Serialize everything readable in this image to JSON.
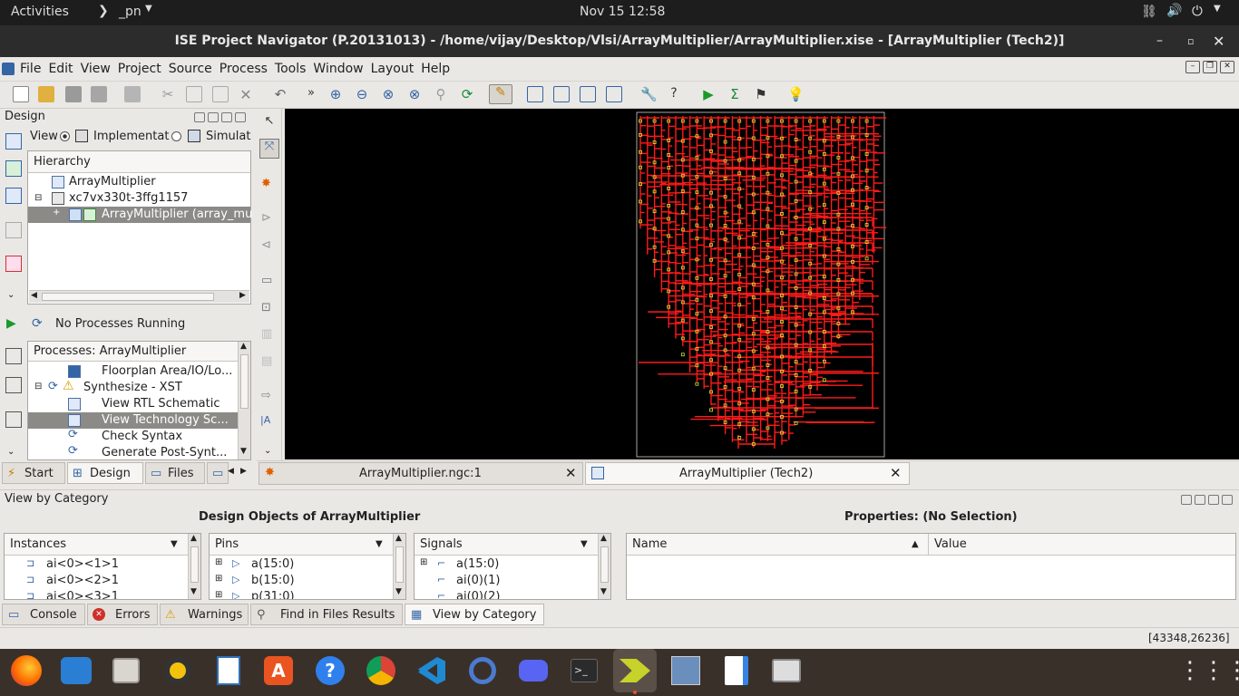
{
  "topbar": {
    "activities": "Activities",
    "app_menu": "_pn",
    "clock": "Nov 15  12:58"
  },
  "window": {
    "title": "ISE Project Navigator (P.20131013) - /home/vijay/Desktop/Vlsi/ArrayMultiplier/ArrayMultiplier.xise - [ArrayMultiplier (Tech2)]"
  },
  "menu": [
    "File",
    "Edit",
    "View",
    "Project",
    "Source",
    "Process",
    "Tools",
    "Window",
    "Layout",
    "Help"
  ],
  "design": {
    "title": "Design",
    "view_label": "View",
    "impl_label": "Implementat",
    "sim_label": "Simulat",
    "hierarchy_label": "Hierarchy",
    "hier_items": [
      "ArrayMultiplier",
      "xc7vx330t-3ffg1157",
      "ArrayMultiplier (array_mu"
    ]
  },
  "process_status": "No Processes Running",
  "processes": {
    "title": "Processes: ArrayMultiplier",
    "items": [
      "Floorplan Area/IO/Lo...",
      "Synthesize - XST",
      "View RTL Schematic",
      "View Technology Sc...",
      "Check Syntax",
      "Generate Post-Synt..."
    ]
  },
  "left_tabs": [
    "Start",
    "Design",
    "Files"
  ],
  "editor_tabs": [
    "ArrayMultiplier.ngc:1",
    "ArrayMultiplier (Tech2)"
  ],
  "category": {
    "title": "View by Category",
    "design_objects_title": "Design Objects of ArrayMultiplier",
    "properties_title": "Properties: (No Selection)",
    "instances": {
      "header": "Instances",
      "items": [
        "ai<0><1>1",
        "ai<0><2>1",
        "ai<0><3>1"
      ]
    },
    "pins": {
      "header": "Pins",
      "items": [
        "a(15:0)",
        "b(15:0)",
        "p(31:0)"
      ]
    },
    "signals": {
      "header": "Signals",
      "items": [
        "a(15:0)",
        "ai(0)(1)",
        "ai(0)(2)"
      ]
    },
    "prop_headers": {
      "name": "Name",
      "value": "Value"
    }
  },
  "bottom_tabs": [
    "Console",
    "Errors",
    "Warnings",
    "Find in Files Results",
    "View by Category"
  ],
  "status_coords": "[43348,26236]",
  "colors": {
    "schematic_bg": "#000000",
    "wire": "#ff1a1a",
    "pin": "#cfe83a",
    "accent": "#e95420"
  }
}
